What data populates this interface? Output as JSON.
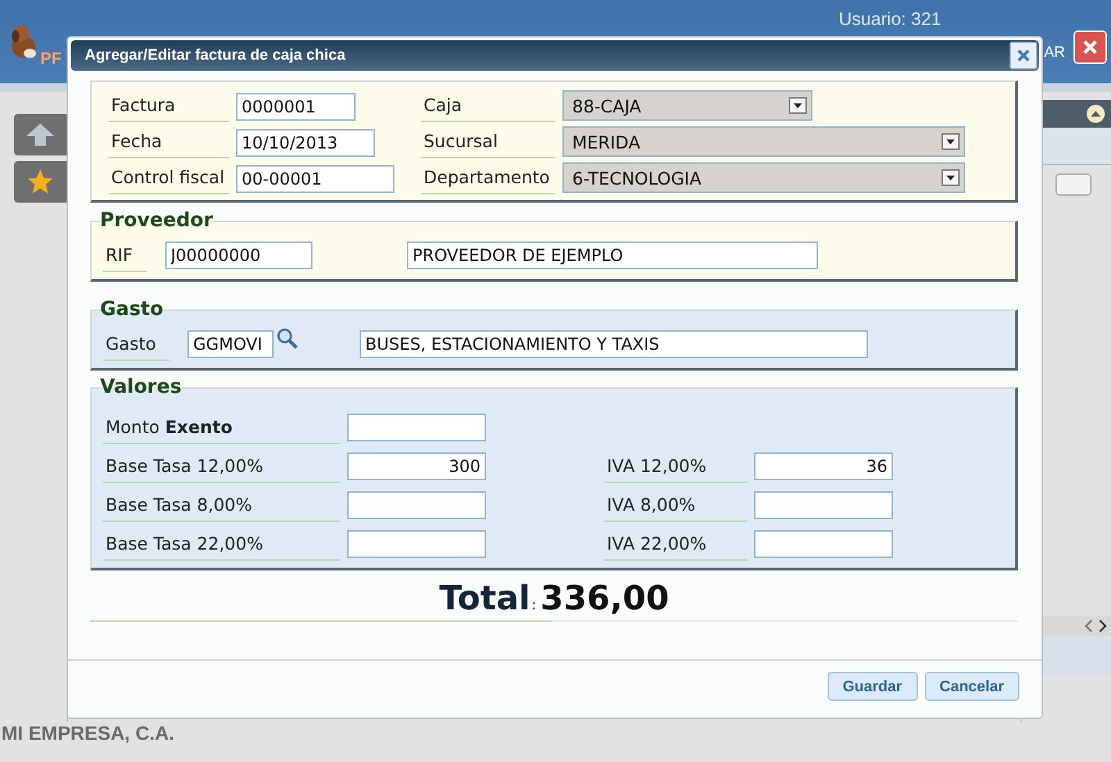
{
  "header": {
    "logo_text": "PF",
    "user": "Usuario: 321",
    "link": "AR"
  },
  "dialog": {
    "title": "Agregar/Editar factura de caja chica",
    "general": [
      {
        "left": {
          "label": "Factura",
          "value": "0000001"
        },
        "right": {
          "label": "Caja",
          "value": "88-CAJA"
        }
      },
      {
        "left": {
          "label": "Fecha",
          "value": "10/10/2013"
        },
        "right": {
          "label": "Sucursal",
          "value": "MERIDA"
        }
      },
      {
        "left": {
          "label": "Control fiscal",
          "value": "00-00001"
        },
        "right": {
          "label": "Departamento",
          "value": "6-TECNOLOGIA"
        }
      }
    ],
    "proveedor": {
      "title": "Proveedor",
      "label": "RIF",
      "code": "J00000000",
      "name": "PROVEEDOR DE EJEMPLO"
    },
    "gasto": {
      "title": "Gasto",
      "label": "Gasto",
      "code": "GGMOVI",
      "name": "BUSES, ESTACIONAMIENTO Y TAXIS"
    },
    "valores": {
      "title": "Valores",
      "rows": [
        {
          "left": {
            "label": "Monto **Exento**"
          }
        },
        {
          "left": {
            "label": "Base Tasa 12,00%",
            "value": "300"
          },
          "right": {
            "label": "IVA 12,00%",
            "value": "36"
          }
        },
        {
          "left": {
            "label": "Base Tasa 8,00%"
          },
          "right": {
            "label": "IVA 8,00%"
          }
        },
        {
          "left": {
            "label": "Base Tasa 22,00%"
          },
          "right": {
            "label": "IVA 22,00%"
          }
        }
      ]
    },
    "total": {
      "label": "Total",
      "separator": ":",
      "value": "336,00"
    },
    "buttons": [
      "Guardar",
      "Cancelar"
    ]
  },
  "footer": {
    "company": "MI EMPRESA, C.A."
  }
}
